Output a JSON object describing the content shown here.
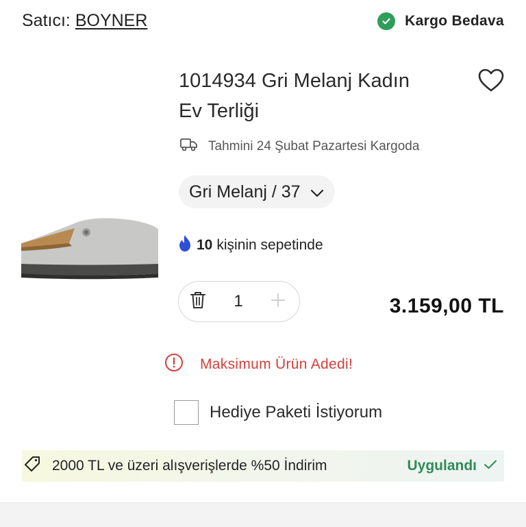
{
  "seller": {
    "label": "Satıcı:",
    "name": "BOYNER"
  },
  "shipping": {
    "label": "Kargo Bedava",
    "icon": "check-circle-icon",
    "color": "#2e9e5a"
  },
  "product": {
    "title_line1": "1014934 Gri Melanj Kadın",
    "title_line2": "Ev Terliği",
    "delivery": "Tahmini 24 Şubat Pazartesi Kargoda",
    "variant": "Gri Melanj / 37",
    "basket_count": "10",
    "basket_text": "kişinin sepetinde",
    "quantity": "1",
    "price": "3.159,00 TL"
  },
  "warning": {
    "text": "Maksimum Ürün Adedi!",
    "color": "#d4403a"
  },
  "gift": {
    "label": "Hediye Paketi İstiyorum",
    "checked": false
  },
  "promo": {
    "text": "2000 TL ve üzeri alışverişlerde %50 İndirim",
    "status": "Uygulandı",
    "status_color": "#2e8b57"
  }
}
